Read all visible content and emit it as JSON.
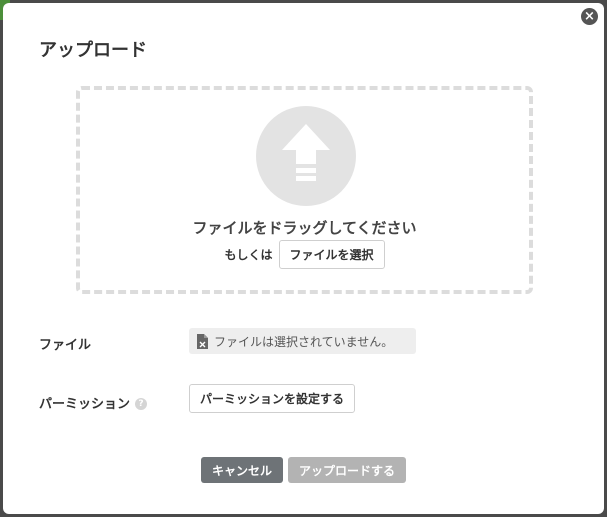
{
  "dialog": {
    "title": "アップロード",
    "close_icon": "close-icon"
  },
  "dropzone": {
    "icon": "upload-arrow-icon",
    "drag_text": "ファイルをドラッグしてください",
    "or_text": "もしくは",
    "select_button_label": "ファイルを選択"
  },
  "file_row": {
    "label": "ファイル",
    "icon": "file-icon",
    "status_text": "ファイルは選択されていません。"
  },
  "permission_row": {
    "label": "パーミッション",
    "help_icon": "help-icon",
    "help_glyph": "?",
    "button_label": "パーミッションを設定する"
  },
  "footer": {
    "cancel_label": "キャンセル",
    "upload_label": "アップロードする",
    "upload_disabled": true
  },
  "colors": {
    "cancel_button": "#6e7377",
    "upload_button_disabled": "#b3b3b3",
    "dropzone_border": "#dcdcdc",
    "icon_circle": "#e3e3e3"
  }
}
